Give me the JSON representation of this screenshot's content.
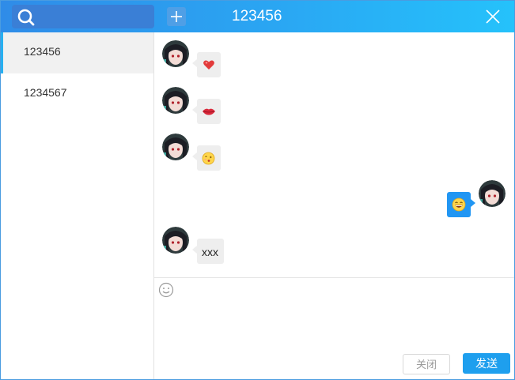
{
  "header": {
    "title": "123456",
    "search_icon": "search-icon",
    "add_icon": "plus-icon",
    "close_icon": "close-icon",
    "gradient_start": "#2f8ce8",
    "gradient_end": "#25c2fb"
  },
  "sidebar": {
    "contacts": [
      {
        "label": "123456",
        "active": true
      },
      {
        "label": "1234567",
        "active": false
      }
    ],
    "accent": "#27b0f0"
  },
  "chat": {
    "messages": [
      {
        "side": "left",
        "type": "emoji",
        "emoji": "heart-icon"
      },
      {
        "side": "left",
        "type": "emoji",
        "emoji": "lips-icon"
      },
      {
        "side": "left",
        "type": "emoji",
        "emoji": "kiss-face-icon"
      },
      {
        "side": "right",
        "type": "emoji",
        "emoji": "grin-face-icon"
      },
      {
        "side": "left",
        "type": "text",
        "text": "xxx"
      }
    ],
    "outgoing_bubble_color": "#2196f3",
    "incoming_bubble_color": "#eeeeee"
  },
  "composer": {
    "emoji_icon": "smiley-icon",
    "input_value": "",
    "close_label": "关闭",
    "send_label": "发送",
    "send_color": "#1e9fee"
  }
}
